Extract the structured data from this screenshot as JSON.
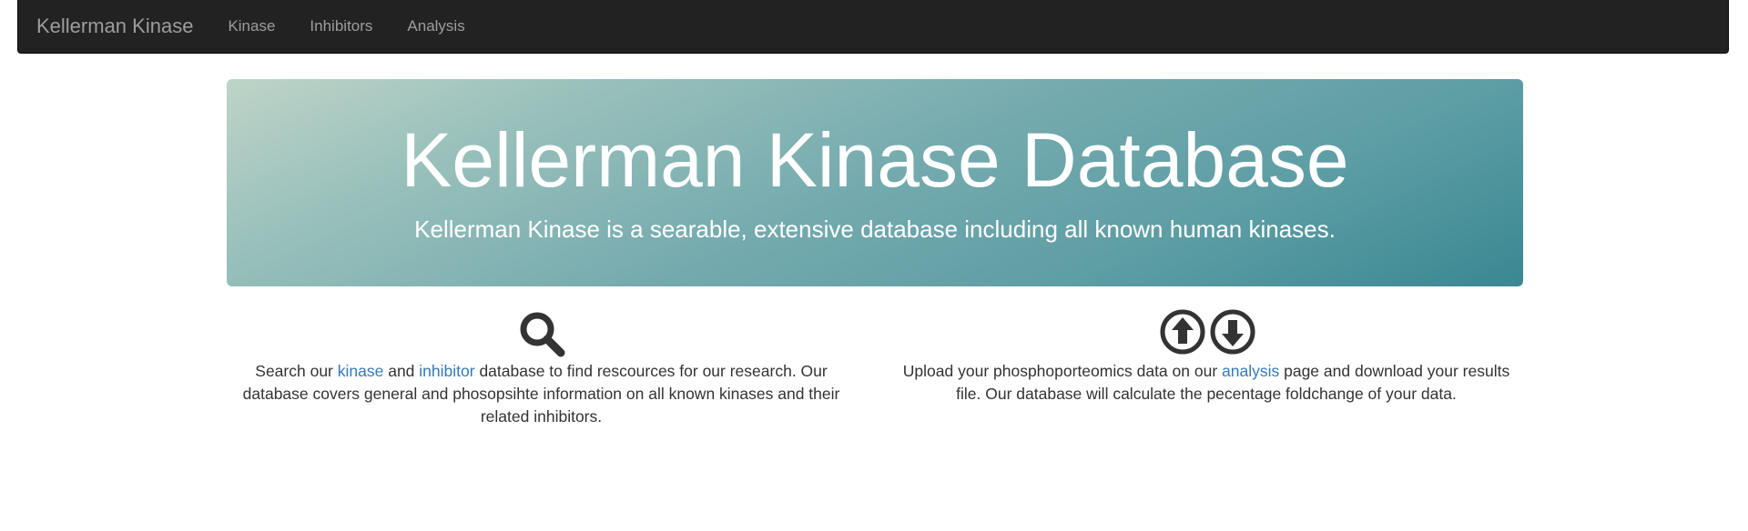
{
  "navbar": {
    "brand": "Kellerman Kinase",
    "items": [
      {
        "label": "Kinase"
      },
      {
        "label": "Inhibitors"
      },
      {
        "label": "Analysis"
      }
    ]
  },
  "jumbotron": {
    "title": "Kellerman Kinase Database",
    "subtitle": "Kellerman Kinase is a searable, extensive database including all known human kinases."
  },
  "features": {
    "search": {
      "icon": "search-icon",
      "text_1": "Search our ",
      "link_kinase": "kinase",
      "text_2": " and ",
      "link_inhibitor": "inhibitor",
      "text_3": " database to find rescources for our research. Our database covers general and phosopsihte information on all known kinases and their related inhibitors."
    },
    "analysis": {
      "icons": [
        "upload-icon",
        "download-icon"
      ],
      "text_1": "Upload your phosphoporteomics data on our ",
      "link_analysis": "analysis",
      "text_2": " page and download your results file. Our database will calculate the pecentage foldchange of your data."
    }
  },
  "colors": {
    "navbar_bg": "#222222",
    "nav_text": "#9d9d9d",
    "link": "#337ab7",
    "jumbotron_start": "#bed4c8",
    "jumbotron_end": "#3a8792"
  }
}
